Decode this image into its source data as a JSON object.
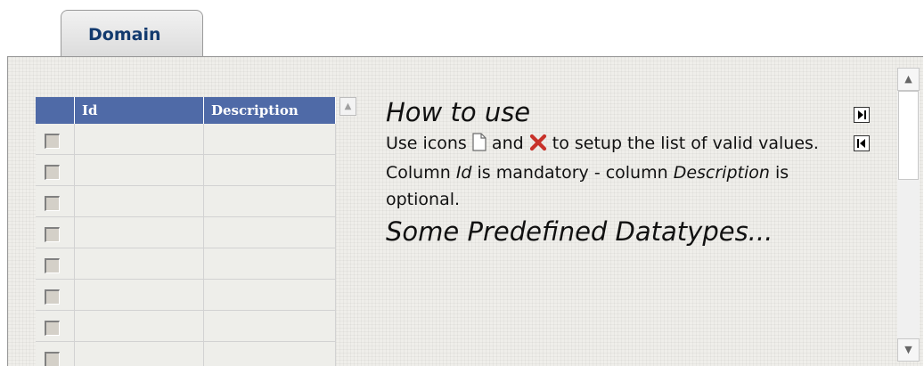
{
  "tab": {
    "label": "Domain"
  },
  "grid": {
    "columns": {
      "id": "Id",
      "description": "Description"
    },
    "rows": [
      {
        "id": "",
        "description": ""
      },
      {
        "id": "",
        "description": ""
      },
      {
        "id": "",
        "description": ""
      },
      {
        "id": "",
        "description": ""
      },
      {
        "id": "",
        "description": ""
      },
      {
        "id": "",
        "description": ""
      },
      {
        "id": "",
        "description": ""
      },
      {
        "id": "",
        "description": ""
      }
    ]
  },
  "help": {
    "title": "How to use",
    "text_1": "Use icons",
    "text_and": "and",
    "text_2": "to setup the list of valid values. Column",
    "id_term": "Id",
    "text_3": "is mandatory - column",
    "description_term": "Description",
    "text_4": "is optional.",
    "subtitle": "Some Predefined Datatypes..."
  },
  "icons": {
    "new": "new-document-icon",
    "delete": "delete-x-icon",
    "expand": "expand-panel-icon",
    "collapse": "collapse-panel-icon"
  },
  "colors": {
    "header": "#4f6aa7",
    "panel": "#efeeea",
    "tab_text": "#123a6e",
    "delete_icon": "#c8322a"
  }
}
